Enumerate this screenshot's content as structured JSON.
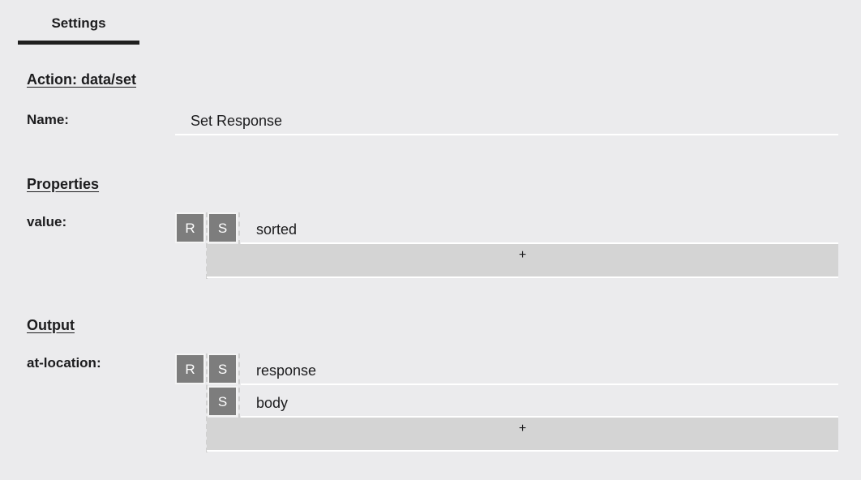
{
  "tabs": [
    {
      "label": "Settings"
    }
  ],
  "action": {
    "title": "Action: data/set"
  },
  "name": {
    "label": "Name:",
    "value": "Set Response"
  },
  "properties": {
    "title": "Properties",
    "value_label": "value:",
    "badges": [
      "R",
      "S"
    ],
    "items": [
      "sorted"
    ],
    "add_label": "+"
  },
  "output": {
    "title": "Output",
    "location_label": "at-location:",
    "root_badge": "R",
    "segment_badge": "S",
    "items": [
      "response",
      "body"
    ],
    "add_label": "+"
  }
}
